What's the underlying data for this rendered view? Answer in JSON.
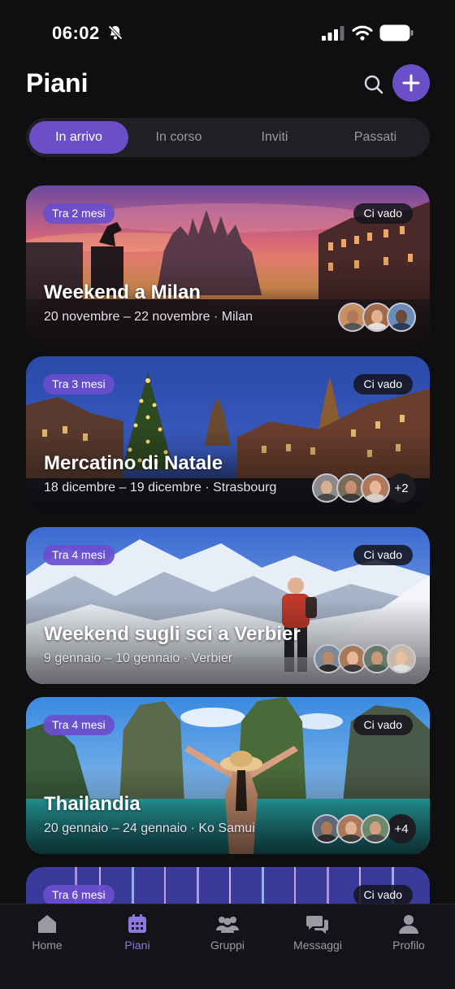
{
  "status_bar": {
    "time": "06:02"
  },
  "header": {
    "title": "Piani"
  },
  "tabs": [
    {
      "label": "In arrivo"
    },
    {
      "label": "In corso"
    },
    {
      "label": "Inviti"
    },
    {
      "label": "Passati"
    }
  ],
  "cards": [
    {
      "badge": "Tra 2 mesi",
      "status": "Ci vado",
      "title": "Weekend a Milan",
      "subtitle": "20 novembre – 22 novembre · Milan",
      "more": ""
    },
    {
      "badge": "Tra 3 mesi",
      "status": "Ci vado",
      "title": "Mercatino di Natale",
      "subtitle": "18 dicembre – 19 dicembre · Strasbourg",
      "more": "+2"
    },
    {
      "badge": "Tra 4 mesi",
      "status": "Ci vado",
      "title": "Weekend sugli sci a Verbier",
      "subtitle": "9 gennaio – 10 gennaio · Verbier",
      "more": ""
    },
    {
      "badge": "Tra 4 mesi",
      "status": "Ci vado",
      "title": "Thailandia",
      "subtitle": "20 gennaio – 24 gennaio · Ko Samui",
      "more": "+4"
    },
    {
      "badge": "Tra 6 mesi",
      "status": "Ci vado",
      "title": "",
      "subtitle": "",
      "more": ""
    }
  ],
  "nav": [
    {
      "label": "Home",
      "icon": "home-icon"
    },
    {
      "label": "Piani",
      "icon": "calendar-icon"
    },
    {
      "label": "Gruppi",
      "icon": "group-icon"
    },
    {
      "label": "Messaggi",
      "icon": "messages-icon"
    },
    {
      "label": "Profilo",
      "icon": "profile-icon"
    }
  ],
  "colors": {
    "accent": "#6b4fc9",
    "background": "#0f0f12",
    "nav_active": "#8e78e0"
  }
}
